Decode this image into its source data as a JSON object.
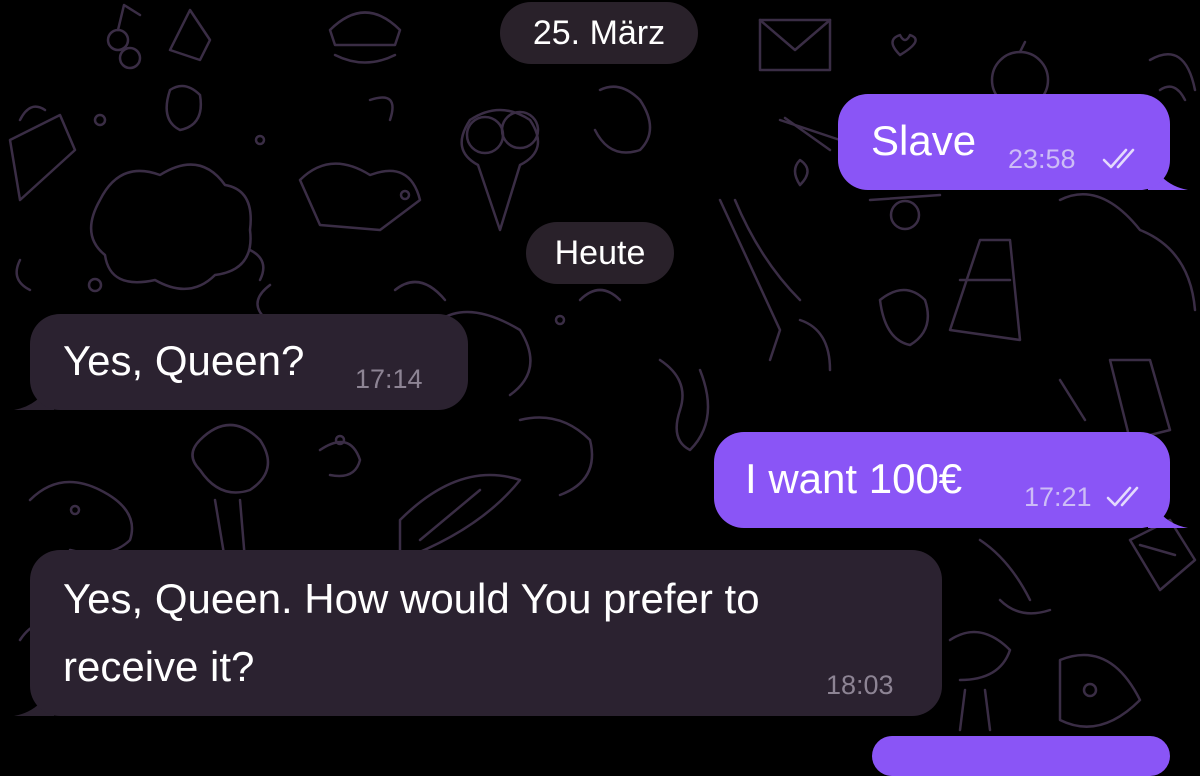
{
  "chat": {
    "date_separators": [
      "25. März",
      "Heute"
    ],
    "messages": [
      {
        "direction": "outgoing",
        "text": "Slave",
        "time": "23:58",
        "status": "read"
      },
      {
        "direction": "incoming",
        "text": "Yes, Queen?",
        "time": "17:14"
      },
      {
        "direction": "outgoing",
        "text": "I want 100€",
        "time": "17:21",
        "status": "read"
      },
      {
        "direction": "incoming",
        "text_lines": [
          "Yes, Queen. How would You prefer to",
          "receive it?"
        ],
        "time": "18:03"
      }
    ]
  },
  "colors": {
    "background": "#000000",
    "outgoing_bubble": "#8a55f6",
    "incoming_bubble": "#2b2230",
    "date_pill": "#2c242e",
    "doodle_stroke": "#3a2d45"
  },
  "icons": {
    "read_status": "double-check-icon"
  }
}
